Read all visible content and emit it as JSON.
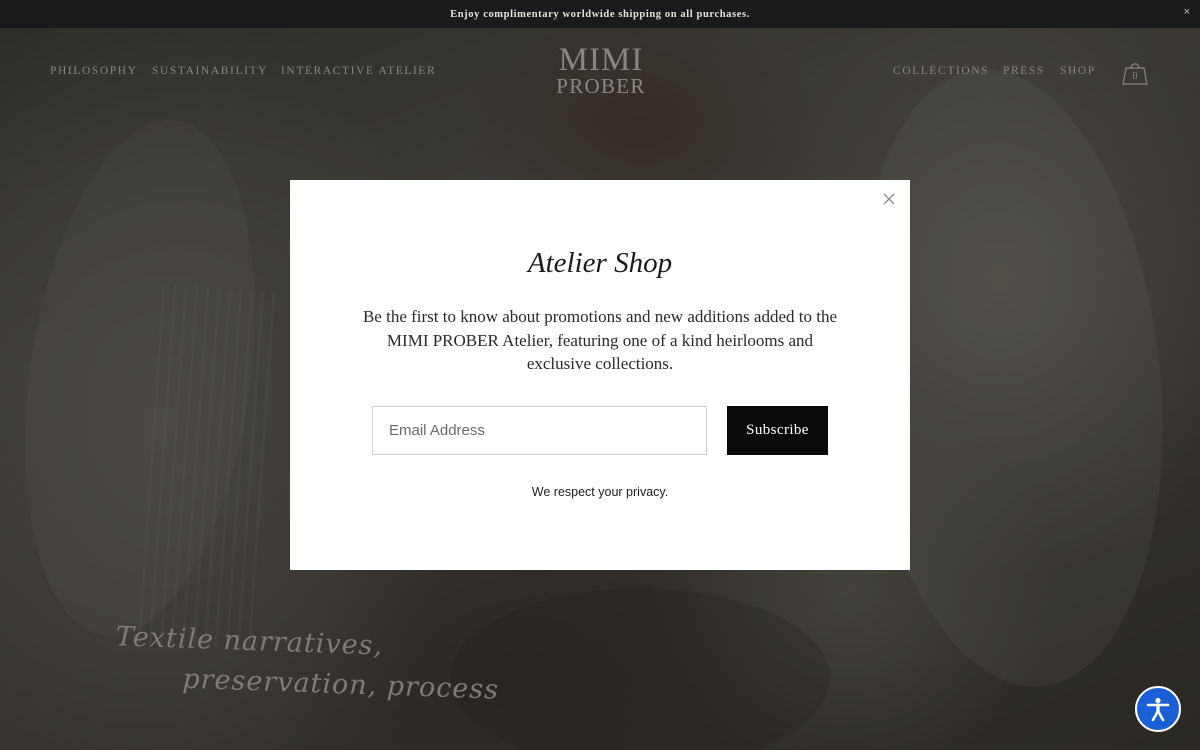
{
  "announcement": {
    "text": "Enjoy complimentary worldwide shipping on all purchases.",
    "close": "×"
  },
  "header": {
    "nav_left": [
      "PHILOSOPHY",
      "SUSTAINABILITY",
      "INTERACTIVE ATELIER"
    ],
    "logo_line1": "MIMI",
    "logo_line2": "PROBER",
    "nav_right": [
      "COLLECTIONS",
      "PRESS",
      "SHOP"
    ],
    "cart_count": "0"
  },
  "hero": {
    "tagline_line1": "Textile narratives,",
    "tagline_line2": "preservation, process"
  },
  "modal": {
    "title": "Atelier Shop",
    "body": "Be the first to know about promotions and new additions added to the MIMI PROBER Atelier, featuring one of a kind heirlooms and exclusive collections.",
    "email_placeholder": "Email Address",
    "subscribe_label": "Subscribe",
    "privacy_note": "We respect your privacy."
  },
  "colors": {
    "accessibility_button": "#1a5fd6",
    "subscribe_button": "#0b0b0b",
    "topbar": "#1a1a1a"
  },
  "icons": [
    "close-icon",
    "cart-icon",
    "accessibility-icon"
  ]
}
